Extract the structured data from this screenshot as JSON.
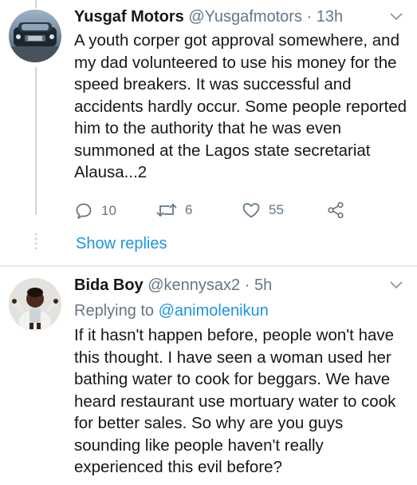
{
  "tweets": [
    {
      "name": "Yusgaf Motors",
      "handle": "@Yusgafmotors",
      "separator": "·",
      "time": "13h",
      "text": "A youth corper got approval somewhere, and my dad volunteered to use his money for the speed breakers. It was successful and accidents hardly occur. Some people reported him to the authority that he was even summoned at the Lagos state secretariat Alausa...2",
      "replies": "10",
      "retweets": "6",
      "likes": "55",
      "show_replies": "Show replies"
    },
    {
      "name": "Bida Boy",
      "handle": "@kennysax2",
      "separator": "·",
      "time": "5h",
      "replying_to_label": "Replying to",
      "replying_to_handle": "@animolenikun",
      "text": "If it hasn't happen before, people won't have this thought. I have seen a woman used her bathing water to cook for beggars. We have heard restaurant use mortuary water to cook for better sales. So why are you guys sounding like people haven't really experienced this evil before?"
    }
  ],
  "icons": {
    "reply": "comment-icon",
    "retweet": "retweet-icon",
    "like": "heart-icon",
    "share": "share-icon",
    "more": "chevron-down-icon"
  },
  "colors": {
    "link": "#1b95e0",
    "secondary_text": "#657786",
    "primary_text": "#14171a",
    "divider": "#e6ecf0"
  }
}
